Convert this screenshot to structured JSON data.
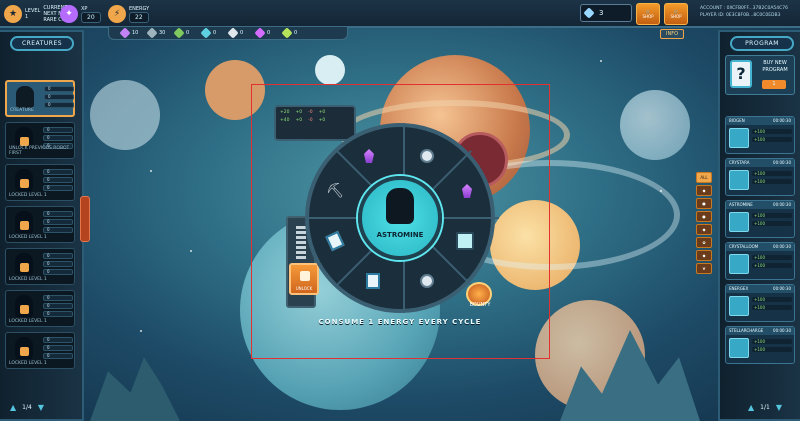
{
  "colors": {
    "accent": "#f0a64a",
    "cyan": "#4fe0e6",
    "panel": "#1a3345",
    "focus": "#e2312f"
  },
  "topbar": {
    "level": {
      "label": "LEVEL",
      "value": "1",
      "current_label": "CURRENT",
      "next_label": "NEXT NEXT",
      "rare_label": "RARE COIN"
    },
    "xp": {
      "label": "XP",
      "value": "20"
    },
    "energy": {
      "label": "ENERGY",
      "value": "22"
    },
    "gems": "3",
    "shop_labels": [
      "SHOP",
      "SHOP"
    ],
    "account": {
      "account_line": "ACCOUNT : 0XCFB0FF...37B2C0A54C76",
      "player_line": "PLAYER ID: 0E3C8F0B...8C0C0EDB3"
    }
  },
  "resources": [
    {
      "icon": "crystal-icon",
      "value": "10",
      "color": "#c383f5"
    },
    {
      "icon": "stone-icon",
      "value": "30",
      "color": "#9fb3bf"
    },
    {
      "icon": "ore-icon",
      "value": "0",
      "color": "#7fc95f"
    },
    {
      "icon": "gem-icon",
      "value": "0",
      "color": "#5fd0e0"
    },
    {
      "icon": "flower-icon",
      "value": "0",
      "color": "#e0e6ea"
    },
    {
      "icon": "shard-icon",
      "value": "0",
      "color": "#d46cff"
    },
    {
      "icon": "leaf-icon",
      "value": "0",
      "color": "#b6e35a"
    }
  ],
  "info_label": "INFO",
  "left": {
    "title": "CREATURES",
    "slots": [
      {
        "label": "CREATURE",
        "active": true,
        "stats": [
          "0",
          "0",
          "0"
        ]
      },
      {
        "label": "UNLOCK PREVIOUS ROBOT FIRST",
        "active": false,
        "stats": [
          "0",
          "0",
          "0"
        ]
      },
      {
        "label": "LOCKED   LEVEL 1",
        "active": false,
        "stats": [
          "0",
          "0",
          "0"
        ]
      },
      {
        "label": "LOCKED   LEVEL 1",
        "active": false,
        "stats": [
          "0",
          "0",
          "0"
        ]
      },
      {
        "label": "LOCKED   LEVEL 1",
        "active": false,
        "stats": [
          "0",
          "0",
          "0"
        ]
      },
      {
        "label": "LOCKED   LEVEL 1",
        "active": false,
        "stats": [
          "0",
          "0",
          "0"
        ]
      },
      {
        "label": "LOCKED   LEVEL 1",
        "active": false,
        "stats": [
          "0",
          "0",
          "0"
        ]
      }
    ],
    "pager": "1/4"
  },
  "right": {
    "title": "PROGRAM",
    "buy": {
      "title": "BUY NEW PROGRAM",
      "price": "1"
    },
    "programs": [
      {
        "name": "BIOGEN",
        "time": "00:00:30",
        "lines": [
          "+100",
          "+100"
        ]
      },
      {
        "name": "CRYSTARA",
        "time": "00:00:30",
        "lines": [
          "+100",
          "+100"
        ]
      },
      {
        "name": "ASTROMINE",
        "time": "00:00:30",
        "lines": [
          "+100",
          "+100"
        ]
      },
      {
        "name": "CRYSTALLOOM",
        "time": "00:00:30",
        "lines": [
          "+100",
          "+100"
        ]
      },
      {
        "name": "ENERGEX",
        "time": "00:00:30",
        "lines": [
          "+100",
          "+100"
        ]
      },
      {
        "name": "STELLARCHARGE",
        "time": "00:00:30",
        "lines": [
          "+100",
          "+100"
        ]
      }
    ],
    "filters": [
      "ALL",
      "",
      "",
      "",
      "",
      "",
      "",
      ""
    ],
    "pager": "1/1"
  },
  "center": {
    "hub_label": "ASTROMINE",
    "stats_card": [
      [
        "+20",
        "+0",
        "-0",
        "+0"
      ],
      [
        "+40",
        "+0",
        "-0",
        "+0"
      ]
    ],
    "lock_label": "UNLOCK",
    "bounty_label": "BOUNTY",
    "consume_text": "CONSUME 1 ENERGY EVERY CYCLE",
    "wheel_icons": [
      "pick-icon",
      "crystal-icon",
      "microscope-icon",
      "crystal-icon",
      "screen-icon",
      "microscope-icon",
      "card-icon",
      "card-icon"
    ]
  }
}
